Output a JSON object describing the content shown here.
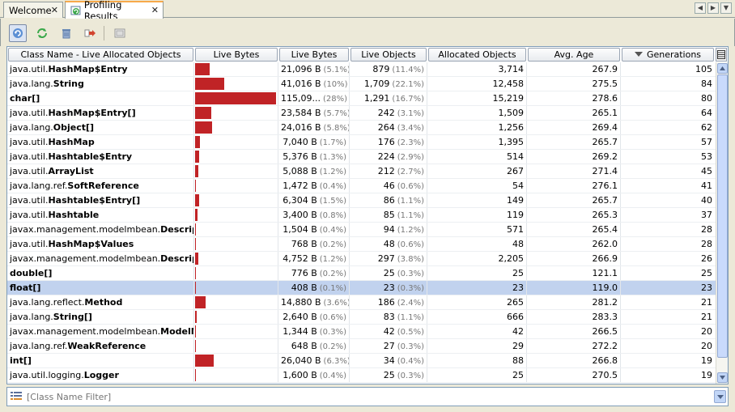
{
  "tabs": [
    {
      "label": "Welcome",
      "active": false
    },
    {
      "label": "Profiling Results",
      "active": true
    }
  ],
  "toolbar": {
    "buttons": [
      {
        "icon": "update-results-icon",
        "active": true
      },
      {
        "icon": "auto-refresh-icon",
        "active": false
      },
      {
        "icon": "trash-gc-icon",
        "active": false
      },
      {
        "icon": "export-icon",
        "active": false
      },
      {
        "icon": "snapshot-icon",
        "active": false
      }
    ]
  },
  "table": {
    "columns": [
      "Class Name - Live Allocated Objects",
      "Live Bytes",
      "Live Bytes",
      "Live Objects",
      "Allocated Objects",
      "Avg. Age",
      "Generations"
    ],
    "sorted_column": "Generations",
    "selected_row": 15,
    "rows": [
      {
        "pkg": "java.util.",
        "cls": "HashMap$Entry",
        "bar_pct": 5.1,
        "bytes": "21,096 B",
        "bytes_pct": "(5.1%)",
        "objs": "879",
        "objs_pct": "(11.4%)",
        "alloc": "3,714",
        "age": "267.9",
        "gen": "105"
      },
      {
        "pkg": "java.lang.",
        "cls": "String",
        "bar_pct": 10,
        "bytes": "41,016 B",
        "bytes_pct": "(10%)",
        "objs": "1,709",
        "objs_pct": "(22.1%)",
        "alloc": "12,458",
        "age": "275.5",
        "gen": "84"
      },
      {
        "pkg": "",
        "cls": "char[]",
        "bar_pct": 28,
        "bytes": "115,09...",
        "bytes_pct": "(28%)",
        "objs": "1,291",
        "objs_pct": "(16.7%)",
        "alloc": "15,219",
        "age": "278.6",
        "gen": "80"
      },
      {
        "pkg": "java.util.",
        "cls": "HashMap$Entry[]",
        "bar_pct": 5.7,
        "bytes": "23,584 B",
        "bytes_pct": "(5.7%)",
        "objs": "242",
        "objs_pct": "(3.1%)",
        "alloc": "1,509",
        "age": "265.1",
        "gen": "64"
      },
      {
        "pkg": "java.lang.",
        "cls": "Object[]",
        "bar_pct": 5.8,
        "bytes": "24,016 B",
        "bytes_pct": "(5.8%)",
        "objs": "264",
        "objs_pct": "(3.4%)",
        "alloc": "1,256",
        "age": "269.4",
        "gen": "62"
      },
      {
        "pkg": "java.util.",
        "cls": "HashMap",
        "bar_pct": 1.7,
        "bytes": "7,040 B",
        "bytes_pct": "(1.7%)",
        "objs": "176",
        "objs_pct": "(2.3%)",
        "alloc": "1,395",
        "age": "265.7",
        "gen": "57"
      },
      {
        "pkg": "java.util.",
        "cls": "Hashtable$Entry",
        "bar_pct": 1.3,
        "bytes": "5,376 B",
        "bytes_pct": "(1.3%)",
        "objs": "224",
        "objs_pct": "(2.9%)",
        "alloc": "514",
        "age": "269.2",
        "gen": "53"
      },
      {
        "pkg": "java.util.",
        "cls": "ArrayList",
        "bar_pct": 1.2,
        "bytes": "5,088 B",
        "bytes_pct": "(1.2%)",
        "objs": "212",
        "objs_pct": "(2.7%)",
        "alloc": "267",
        "age": "271.4",
        "gen": "45"
      },
      {
        "pkg": "java.lang.ref.",
        "cls": "SoftReference",
        "bar_pct": 0.4,
        "bytes": "1,472 B",
        "bytes_pct": "(0.4%)",
        "objs": "46",
        "objs_pct": "(0.6%)",
        "alloc": "54",
        "age": "276.1",
        "gen": "41"
      },
      {
        "pkg": "java.util.",
        "cls": "Hashtable$Entry[]",
        "bar_pct": 1.5,
        "bytes": "6,304 B",
        "bytes_pct": "(1.5%)",
        "objs": "86",
        "objs_pct": "(1.1%)",
        "alloc": "149",
        "age": "265.7",
        "gen": "40"
      },
      {
        "pkg": "java.util.",
        "cls": "Hashtable",
        "bar_pct": 0.8,
        "bytes": "3,400 B",
        "bytes_pct": "(0.8%)",
        "objs": "85",
        "objs_pct": "(1.1%)",
        "alloc": "119",
        "age": "265.3",
        "gen": "37"
      },
      {
        "pkg": "javax.management.modelmbean.",
        "cls": "Descripto...",
        "bar_pct": 0.4,
        "bytes": "1,504 B",
        "bytes_pct": "(0.4%)",
        "objs": "94",
        "objs_pct": "(1.2%)",
        "alloc": "571",
        "age": "265.4",
        "gen": "28"
      },
      {
        "pkg": "java.util.",
        "cls": "HashMap$Values",
        "bar_pct": 0.2,
        "bytes": "768 B",
        "bytes_pct": "(0.2%)",
        "objs": "48",
        "objs_pct": "(0.6%)",
        "alloc": "48",
        "age": "262.0",
        "gen": "28"
      },
      {
        "pkg": "javax.management.modelmbean.",
        "cls": "Descripto...",
        "bar_pct": 1.2,
        "bytes": "4,752 B",
        "bytes_pct": "(1.2%)",
        "objs": "297",
        "objs_pct": "(3.8%)",
        "alloc": "2,205",
        "age": "266.9",
        "gen": "26"
      },
      {
        "pkg": "",
        "cls": "double[]",
        "bar_pct": 0.2,
        "bytes": "776 B",
        "bytes_pct": "(0.2%)",
        "objs": "25",
        "objs_pct": "(0.3%)",
        "alloc": "25",
        "age": "121.1",
        "gen": "25"
      },
      {
        "pkg": "",
        "cls": "float[]",
        "bar_pct": 0.1,
        "bytes": "408 B",
        "bytes_pct": "(0.1%)",
        "objs": "23",
        "objs_pct": "(0.3%)",
        "alloc": "23",
        "age": "119.0",
        "gen": "23"
      },
      {
        "pkg": "java.lang.reflect.",
        "cls": "Method",
        "bar_pct": 3.6,
        "bytes": "14,880 B",
        "bytes_pct": "(3.6%)",
        "objs": "186",
        "objs_pct": "(2.4%)",
        "alloc": "265",
        "age": "281.2",
        "gen": "21"
      },
      {
        "pkg": "java.lang.",
        "cls": "String[]",
        "bar_pct": 0.6,
        "bytes": "2,640 B",
        "bytes_pct": "(0.6%)",
        "objs": "83",
        "objs_pct": "(1.1%)",
        "alloc": "666",
        "age": "283.3",
        "gen": "21"
      },
      {
        "pkg": "javax.management.modelmbean.",
        "cls": "ModelMB...",
        "bar_pct": 0.3,
        "bytes": "1,344 B",
        "bytes_pct": "(0.3%)",
        "objs": "42",
        "objs_pct": "(0.5%)",
        "alloc": "42",
        "age": "266.5",
        "gen": "20"
      },
      {
        "pkg": "java.lang.ref.",
        "cls": "WeakReference",
        "bar_pct": 0.2,
        "bytes": "648 B",
        "bytes_pct": "(0.2%)",
        "objs": "27",
        "objs_pct": "(0.3%)",
        "alloc": "29",
        "age": "272.2",
        "gen": "20"
      },
      {
        "pkg": "",
        "cls": "int[]",
        "bar_pct": 6.3,
        "bytes": "26,040 B",
        "bytes_pct": "(6.3%)",
        "objs": "34",
        "objs_pct": "(0.4%)",
        "alloc": "88",
        "age": "266.8",
        "gen": "19"
      },
      {
        "pkg": "java.util.logging.",
        "cls": "Logger",
        "bar_pct": 0.4,
        "bytes": "1,600 B",
        "bytes_pct": "(0.4%)",
        "objs": "25",
        "objs_pct": "(0.3%)",
        "alloc": "25",
        "age": "270.5",
        "gen": "19"
      }
    ]
  },
  "filter": {
    "placeholder": "[Class Name Filter]",
    "value": ""
  },
  "colors": {
    "bar": "#c02326",
    "selection": "#c1d2ee",
    "active_tab_accent": "#f7a94a"
  }
}
